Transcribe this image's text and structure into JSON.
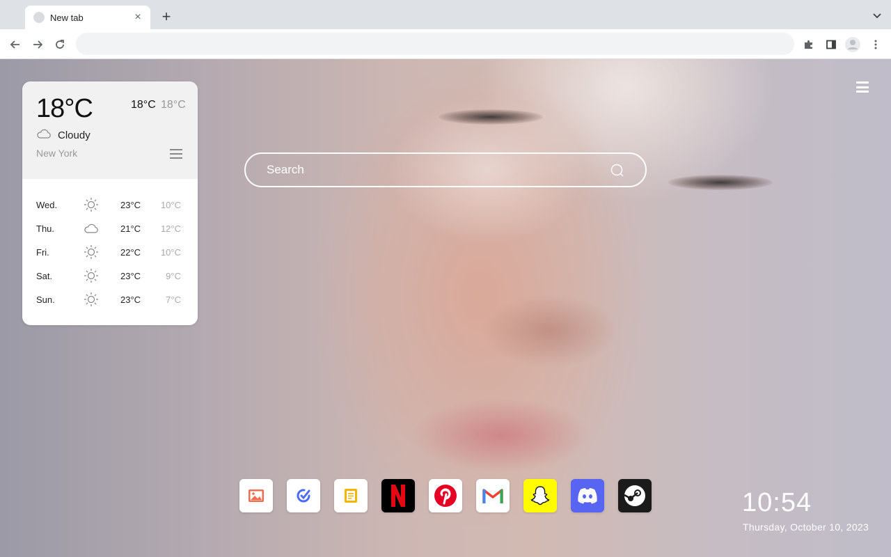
{
  "browser": {
    "tab_title": "New tab",
    "tab_close": "×",
    "new_tab": "+",
    "address_value": "",
    "address_placeholder": ""
  },
  "weather": {
    "current_temp": "18°C",
    "today_high": "18°C",
    "today_low": "18°C",
    "condition": "Cloudy",
    "condition_icon": "cloud-icon",
    "city": "New York",
    "forecast": [
      {
        "day": "Wed.",
        "icon": "sun-icon",
        "high": "23°C",
        "low": "10°C"
      },
      {
        "day": "Thu.",
        "icon": "cloud-icon",
        "high": "21°C",
        "low": "12°C"
      },
      {
        "day": "Fri.",
        "icon": "sun-icon",
        "high": "22°C",
        "low": "10°C"
      },
      {
        "day": "Sat.",
        "icon": "sun-icon",
        "high": "23°C",
        "low": "9°C"
      },
      {
        "day": "Sun.",
        "icon": "sun-icon",
        "high": "23°C",
        "low": "7°C"
      }
    ]
  },
  "search": {
    "placeholder": "Search",
    "value": ""
  },
  "apps": [
    {
      "name": "gallery-app",
      "icon": "image-icon",
      "color": "#ffffff",
      "accent": "#f26d4f"
    },
    {
      "name": "tasks-app",
      "icon": "check-pen-icon",
      "color": "#ffffff",
      "accent": "#4a6cf7"
    },
    {
      "name": "notes-app",
      "icon": "note-icon",
      "color": "#ffffff",
      "accent": "#f4b400"
    },
    {
      "name": "netflix-app",
      "icon": "netflix-logo-icon",
      "color": "#000000",
      "accent": "#e50914"
    },
    {
      "name": "pinterest-app",
      "icon": "pinterest-logo-icon",
      "color": "#ffffff",
      "accent": "#e60023"
    },
    {
      "name": "gmail-app",
      "icon": "gmail-logo-icon",
      "color": "#ffffff",
      "accent": "#ea4335"
    },
    {
      "name": "snapchat-app",
      "icon": "snapchat-ghost-icon",
      "color": "#fffc00",
      "accent": "#ffffff"
    },
    {
      "name": "discord-app",
      "icon": "discord-logo-icon",
      "color": "#5865f2",
      "accent": "#ffffff"
    },
    {
      "name": "steam-app",
      "icon": "steam-logo-icon",
      "color": "#1b1b1b",
      "accent": "#ffffff"
    }
  ],
  "clock": {
    "time": "10:54",
    "date": "Thursday, October 10, 2023"
  }
}
